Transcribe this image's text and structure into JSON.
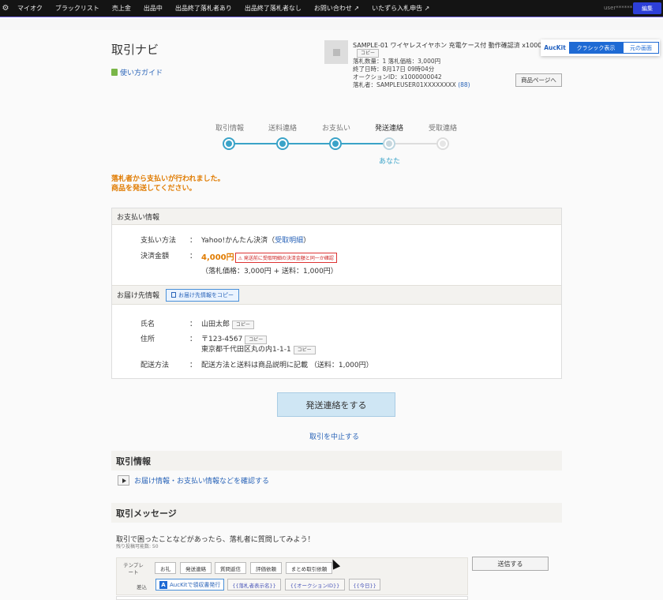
{
  "topnav": {
    "items": [
      "マイオク",
      "ブラックリスト",
      "売上金",
      "出品中",
      "出品終了落札者あり",
      "出品終了落札者なし",
      "お問い合わせ ↗",
      "いたずら入札申告 ↗"
    ],
    "user": "user******",
    "edit_label": "編集"
  },
  "header": {
    "title": "取引ナビ",
    "guide_link": "使い方ガイド"
  },
  "item": {
    "title": "SAMPLE-01 ワイヤレスイヤホン 充電ケース付 動作確認済 x10000",
    "copy_label": "コピー",
    "info_line1": "落札数量：1 落札価格：3,000円",
    "info_line2": "終了日時：8月17日 09時04分",
    "info_line3": "オークションID：x1000000042",
    "bidder": "落札者：SAMPLEUSER01XXXXXXXX",
    "bidder_rating": "(88)",
    "product_page_button": "商品ページへ"
  },
  "auckit": {
    "logo": "AucKit",
    "classic_label": "クラシック表示",
    "original_label": "元の画面"
  },
  "steps": {
    "labels": [
      "取引情報",
      "送料連絡",
      "お支払い",
      "発送連絡",
      "受取連絡"
    ],
    "current_index": 3,
    "you_label": "あなた"
  },
  "alert": {
    "line1": "落札者から支払いが行われました。",
    "line2": "商品を発送してください。"
  },
  "payment": {
    "header": "お支払い情報",
    "method_label": "支払い方法",
    "method_value": "Yahoo!かんたん決済（",
    "method_link": "受取明細",
    "method_close": "）",
    "amount_label": "決済金額",
    "amount_value": "4,000円",
    "amount_warning": "⚠ 発送前に受取明細の決済金額と同一か確認",
    "amount_breakdown": "（落札価格：3,000円 + 送料：1,000円）"
  },
  "delivery": {
    "header": "お届け先情報",
    "copy_button": "お届け先情報をコピー",
    "name_label": "氏名",
    "name_value": "山田太郎",
    "address_label": "住所",
    "postal": "〒123-4567",
    "address": "東京都千代田区丸の内1-1-1",
    "shipping_label": "配送方法",
    "shipping_value": "配送方法と送料は商品説明に記載 （送料：1,000円）",
    "copy_label": "コピー",
    "colon": "："
  },
  "actions": {
    "send_button": "発送連絡をする",
    "cancel_link": "取引を中止する"
  },
  "transaction_info": {
    "header": "取引情報",
    "confirm_link": "お届け情報・お支払い情報などを確認する"
  },
  "messages": {
    "header": "取引メッセージ",
    "prompt": "取引で困ったことなどがあったら、落札者に質問してみよう！",
    "remaining": "残り投稿可能数: 50",
    "template_label": "テンプレート",
    "template_buttons": [
      "お礼",
      "発送連絡",
      "質問返信",
      "評価依頼",
      "まとめ取引依頼"
    ],
    "insert_label": "差込",
    "auckit_receipt": "AucKitで領収書発行",
    "insert_buttons": [
      "{{落札者表示名}}",
      "{{オークションID}}",
      "{{今日}}"
    ],
    "send_label": "送信する"
  }
}
